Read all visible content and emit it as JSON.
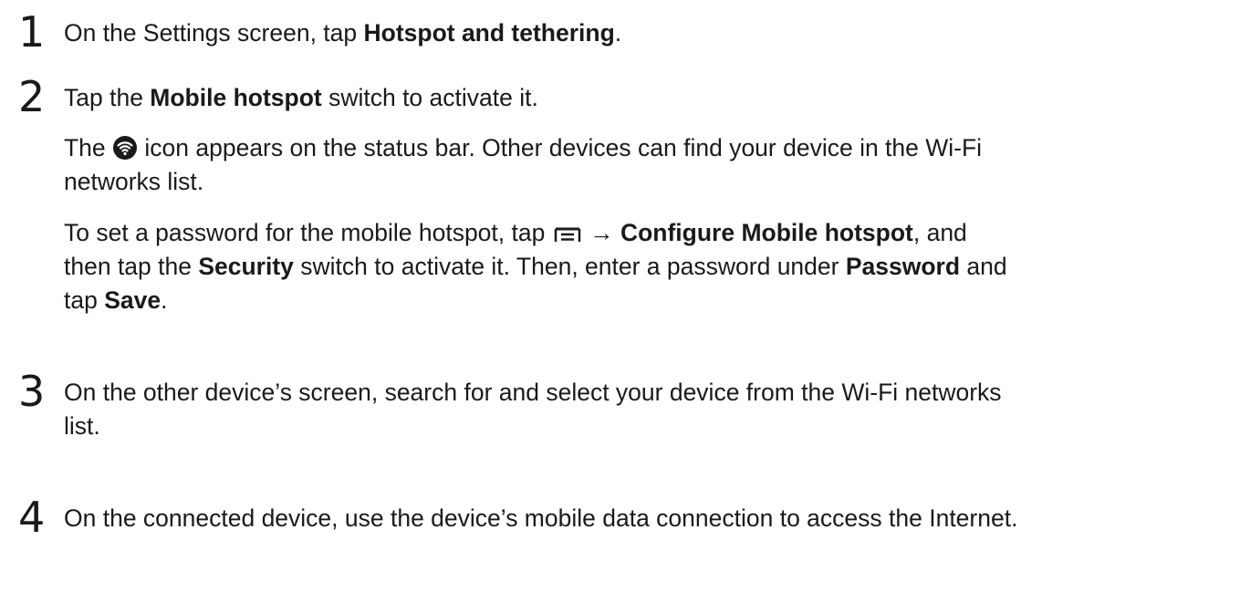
{
  "steps": [
    {
      "number": "1",
      "line1": {
        "pre": "On the Settings screen, tap ",
        "bold": "Hotspot and tethering",
        "post": "."
      }
    },
    {
      "number": "2",
      "line1": {
        "pre": "Tap the ",
        "bold": "Mobile hotspot",
        "post": " switch to activate it."
      },
      "para1": {
        "pre": "The ",
        "post": " icon appears on the status bar. Other devices can find your device in the Wi-Fi",
        "line2": "networks list."
      },
      "para2": {
        "pre": "To set a password for the mobile hotspot, tap ",
        "arrow": " → ",
        "bold1": "Configure Mobile hotspot",
        "mid1": ", and",
        "l2pre": "then tap the ",
        "bold2": "Security",
        "l2mid": " switch to activate it. Then, enter a password under ",
        "bold3": "Password",
        "l2post": " and",
        "l3pre": "tap ",
        "bold4": "Save",
        "l3post": "."
      }
    },
    {
      "number": "3",
      "line1": "On the other device’s screen, search for and select your device from the Wi-Fi networks",
      "line2": "list."
    },
    {
      "number": "4",
      "line1": "On the connected device, use the device’s mobile data connection to access the Internet."
    }
  ],
  "icons": {
    "hotspot": "mobile-hotspot-icon",
    "menu": "more-options-menu-icon"
  }
}
